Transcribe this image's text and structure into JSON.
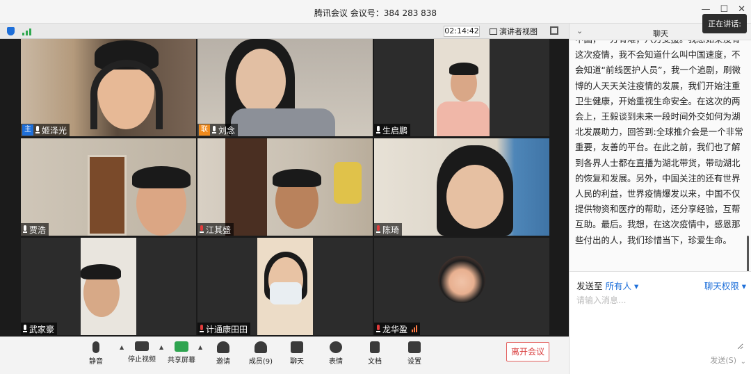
{
  "window": {
    "title": "腾讯会议 会议号：384 283 838"
  },
  "speaking_tip": "正在讲话:",
  "topbar": {
    "timer": "02:14:42",
    "presenter_view": "演讲者视图"
  },
  "participants": [
    {
      "name": "姬泽光",
      "badge": "host"
    },
    {
      "name": "刘念",
      "badge": "cohost"
    },
    {
      "name": "生启鹏",
      "badge": ""
    },
    {
      "name": "贾浩",
      "badge": ""
    },
    {
      "name": "江其盛",
      "badge": "",
      "muted": true
    },
    {
      "name": "陈琦",
      "badge": "",
      "muted": true
    },
    {
      "name": "武家豪",
      "badge": ""
    },
    {
      "name": "计通康田田",
      "badge": "",
      "muted": true
    },
    {
      "name": "龙华盈",
      "badge": "",
      "muted": true,
      "speaking": true
    }
  ],
  "controls": {
    "mute": "静音",
    "stop_video": "停止视频",
    "share_screen": "共享屏幕",
    "invite": "邀请",
    "members": "成员(9)",
    "chat": "聊天",
    "reactions": "表情",
    "docs": "文档",
    "settings": "设置",
    "leave": "离开会议"
  },
  "chat": {
    "title": "聊天",
    "message": "中国，一方有难，八方支援。我想如果没有这次疫情，我不会知道什么叫中国速度，不会知道“前线医护人员”，我一个追剧，刷微博的人天天关注疫情的发展，我们开始注重卫生健康，开始重视生命安全。在这次的两会上，王毅谈到未来一段时间外交如何为湖北发展助力，回答到:全球推介会是一个非常重要，友善的平台。在此之前，我们也了解到各界人士都在直播为湖北带货，带动湖北的恢复和发展。另外，中国关注的还有世界人民的利益，世界疫情爆发以来，中国不仅提供物资和医疗的帮助，还分享经验，互帮互助。最后。我想，在这次疫情中，感恩那些付出的人，我们珍惜当下，珍爱生命。",
    "send_to_label": "发送至",
    "send_to_value": "所有人",
    "permission": "聊天权限",
    "input_placeholder": "请输入消息...",
    "send": "发送(S)"
  }
}
